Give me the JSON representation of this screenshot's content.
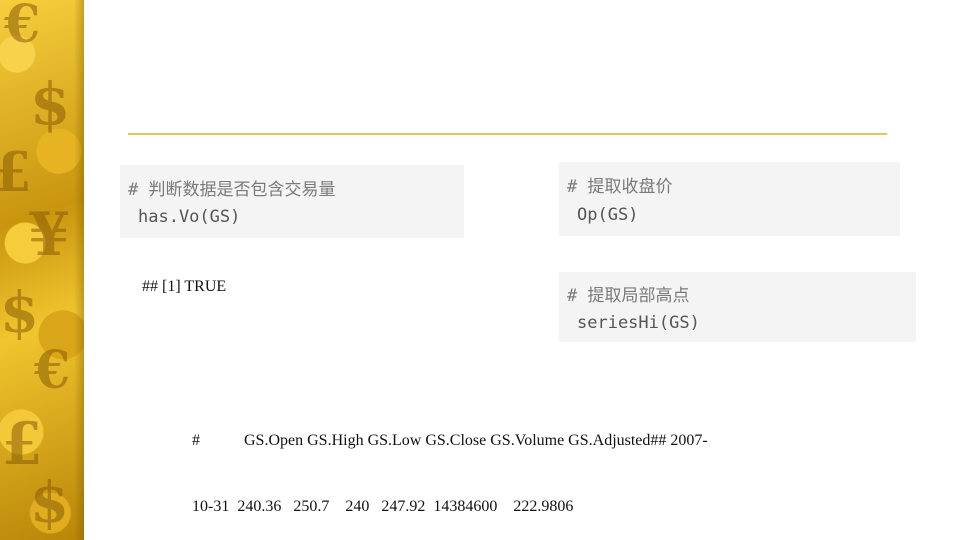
{
  "colors": {
    "accent_rule": "#e8c553",
    "code_bg": "#f4f4f4",
    "strip_gold": "#e6b422"
  },
  "decor": {
    "strip_symbols": [
      "€",
      "$",
      "£",
      "¥",
      "$",
      "€",
      "£",
      "$"
    ]
  },
  "chunk1": {
    "comment": "# 判断数据是否包含交易量",
    "code": "has.Vo(GS)"
  },
  "output1": "## [1] TRUE",
  "chunk2": {
    "comment": "# 提取收盘价",
    "code": "Op(GS)"
  },
  "chunk3": {
    "comment": "# 提取局部高点",
    "code": "seriesHi(GS)"
  },
  "output2": {
    "line1": "#           GS.Open GS.High GS.Low GS.Close GS.Volume GS.Adjusted## 2007-",
    "line2": "10-31  240.36   250.7    240   247.92  14384600    222.9806"
  }
}
